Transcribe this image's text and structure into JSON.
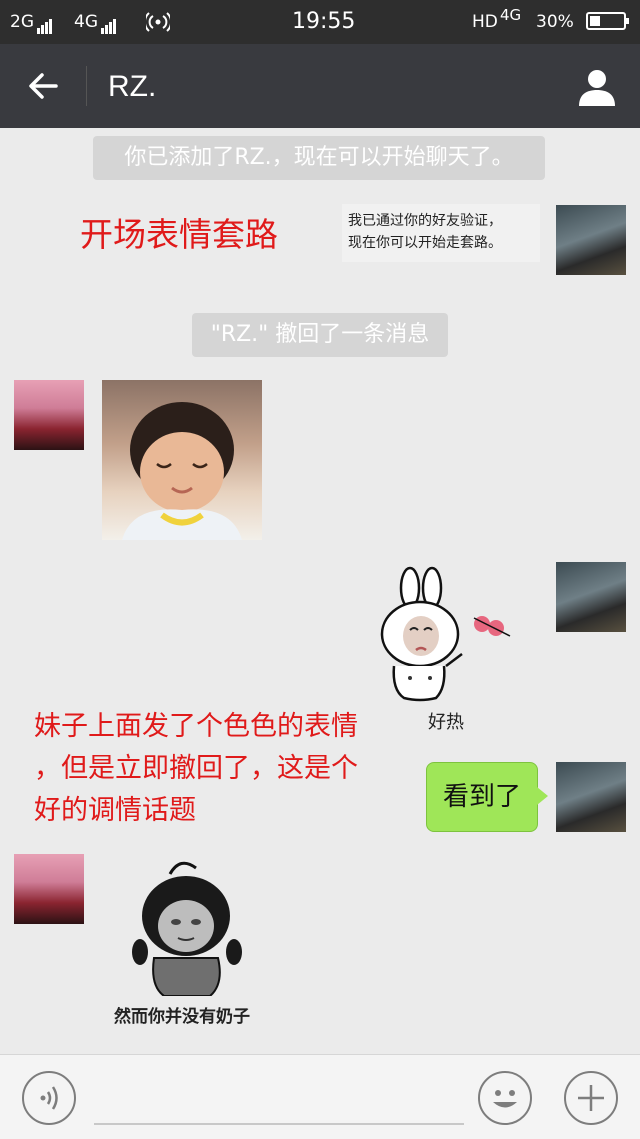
{
  "status_bar": {
    "signal_1": "2G",
    "signal_2": "4G",
    "time": "19:55",
    "network": "HD",
    "network_type": "4G",
    "battery": "30%",
    "battery_level": 0.3
  },
  "header": {
    "title": "RZ."
  },
  "messages": {
    "system_added": "你已添加了RZ.，现在可以开始聊天了。",
    "annotation_1": "开场表情套路",
    "friend_verify_line1": "我已通过你的好友验证，",
    "friend_verify_line2": "现在你可以开始走套路。",
    "system_recalled": "\"RZ.\" 撤回了一条消息",
    "sticker_hot_caption": "好热",
    "annotation_2_line1": "妹子上面发了个色色的表情",
    "annotation_2_line2": "，但是立即撤回了，这是个",
    "annotation_2_line3": "好的调情话题",
    "reply_text": "看到了",
    "sticker_no_caption": "然而你并没有奶子"
  },
  "colors": {
    "title_bar": "#393a3f",
    "status_bar": "#2e2e2e",
    "chat_bg": "#ebebeb",
    "bubble_green": "#9fe658",
    "annotation_red": "#e01a1a"
  }
}
